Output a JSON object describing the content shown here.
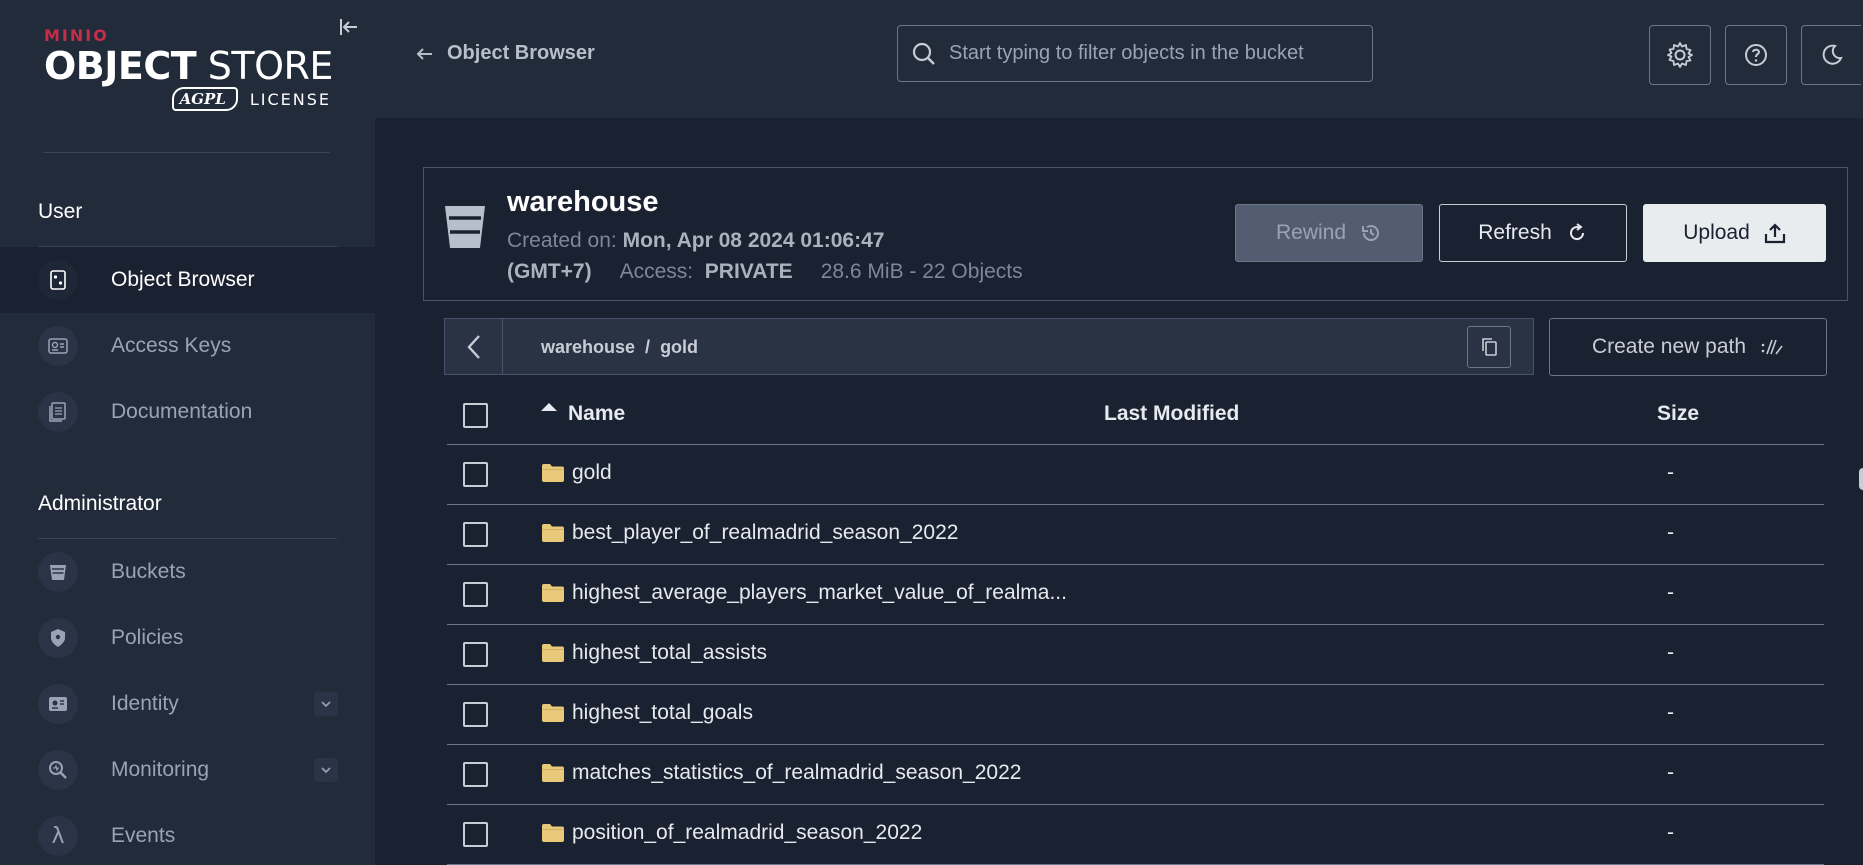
{
  "app": {
    "logo": {
      "brand": "MINIO",
      "product_bold": "OBJECT",
      "product_light": "STORE",
      "license_badge": "AGPL",
      "license_word": "LICENSE"
    }
  },
  "sidebar": {
    "sections": [
      {
        "title": "User",
        "items": [
          {
            "label": "Object Browser",
            "icon": "object-browser-icon",
            "active": true
          },
          {
            "label": "Access Keys",
            "icon": "access-keys-icon"
          },
          {
            "label": "Documentation",
            "icon": "documentation-icon"
          }
        ]
      },
      {
        "title": "Administrator",
        "items": [
          {
            "label": "Buckets",
            "icon": "buckets-icon"
          },
          {
            "label": "Policies",
            "icon": "policies-icon"
          },
          {
            "label": "Identity",
            "icon": "identity-icon",
            "expandable": true
          },
          {
            "label": "Monitoring",
            "icon": "monitoring-icon",
            "expandable": true
          },
          {
            "label": "Events",
            "icon": "lambda-icon"
          }
        ]
      }
    ]
  },
  "topbar": {
    "back_label": "Object Browser",
    "search_placeholder": "Start typing to filter objects in the bucket",
    "buttons": [
      "gear-icon",
      "help-icon",
      "dark-mode-icon"
    ]
  },
  "bucket": {
    "name": "warehouse",
    "created_label": "Created on:",
    "created_value": "Mon, Apr 08 2024 01:06:47",
    "timezone": "(GMT+7)",
    "access_label": "Access:",
    "access_value": "PRIVATE",
    "usage": "28.6 MiB - 22 Objects",
    "rewind_label": "Rewind",
    "refresh_label": "Refresh",
    "upload_label": "Upload"
  },
  "breadcrumb": {
    "root": "warehouse",
    "separator": "/",
    "current": "gold",
    "new_path_label": "Create new path"
  },
  "table": {
    "columns": {
      "name": "Name",
      "modified": "Last Modified",
      "size": "Size"
    },
    "rows": [
      {
        "name": "gold",
        "modified": "",
        "size": "-"
      },
      {
        "name": "best_player_of_realmadrid_season_2022",
        "modified": "",
        "size": "-"
      },
      {
        "name": "highest_average_players_market_value_of_realma...",
        "modified": "",
        "size": "-"
      },
      {
        "name": "highest_total_assists",
        "modified": "",
        "size": "-"
      },
      {
        "name": "highest_total_goals",
        "modified": "",
        "size": "-"
      },
      {
        "name": "matches_statistics_of_realmadrid_season_2022",
        "modified": "",
        "size": "-"
      },
      {
        "name": "position_of_realmadrid_season_2022",
        "modified": "",
        "size": "-"
      }
    ]
  },
  "colors": {
    "sidebar_bg": "#222b3a",
    "main_bg": "#1a2130",
    "brand_red": "#c72c48",
    "folder": "#e8c97a"
  }
}
